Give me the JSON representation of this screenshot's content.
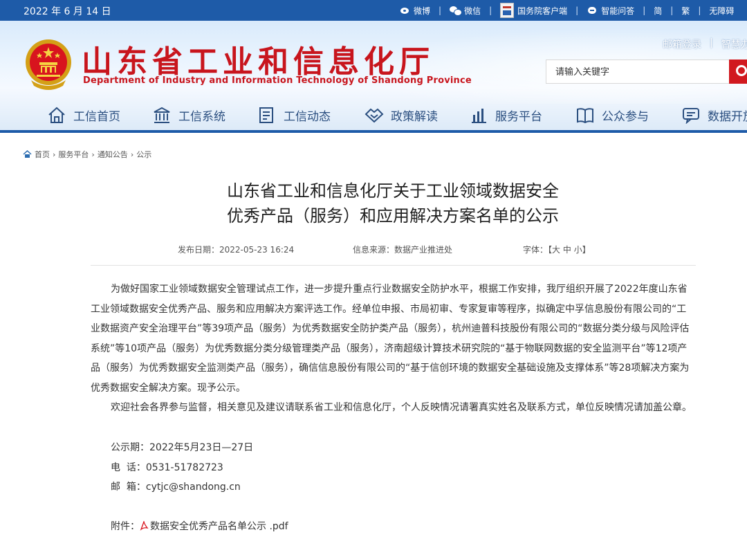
{
  "topbar": {
    "date": "2022 年 6 月 14 日",
    "links": [
      {
        "label": "微博",
        "icon": "weibo-icon"
      },
      {
        "label": "微信",
        "icon": "wechat-icon"
      },
      {
        "label": "国务院客户端",
        "icon": "state-council-app-icon"
      },
      {
        "label": "智能问答",
        "icon": "robot-icon"
      },
      {
        "label": "简"
      },
      {
        "label": "繁"
      },
      {
        "label": "无障碍"
      }
    ],
    "separator": "|"
  },
  "header": {
    "title": "山东省工业和信息化厅",
    "subtitle": "Department of Industry and Information Technology of Shandong Province",
    "login": "邮箱登录",
    "login_sep": "|",
    "smart": "智慧办公",
    "search_placeholder": "请输入关键字",
    "brand_red": "#c8151d",
    "nav_blue": "#1e5ba8"
  },
  "nav": [
    {
      "label": "工信首页",
      "icon": "home-icon"
    },
    {
      "label": "工信系统",
      "icon": "institution-icon"
    },
    {
      "label": "工信动态",
      "icon": "news-icon"
    },
    {
      "label": "政策解读",
      "icon": "handshake-icon"
    },
    {
      "label": "服务平台",
      "icon": "chart-bars-icon"
    },
    {
      "label": "公众参与",
      "icon": "book-icon"
    },
    {
      "label": "数据开放",
      "icon": "chat-icon"
    }
  ],
  "breadcrumb": [
    "首页",
    "服务平台",
    "通知公告",
    "公示"
  ],
  "breadcrumb_sep": "›",
  "article": {
    "title_line1": "山东省工业和信息化厅关于工业领域数据安全",
    "title_line2": "优秀产品（服务）和应用解决方案名单的公示",
    "publish_date": "发布日期：2022-05-23 16:24",
    "source": "信息来源：数据产业推进处",
    "font_size_label": "字体：【",
    "font_large": "大",
    "font_medium": "中",
    "font_small": "小",
    "font_close": "】",
    "paragraph1": "为做好国家工业领域数据安全管理试点工作，进一步提升重点行业数据安全防护水平，根据工作安排，我厅组织开展了2022年度山东省工业领域数据安全优秀产品、服务和应用解决方案评选工作。经单位申报、市局初审、专家复审等程序，拟确定中孚信息股份有限公司的“工业数据资产安全治理平台”等39项产品（服务）为优秀数据安全防护类产品（服务），杭州迪普科技股份有限公司的“数据分类分级与风险评估系统”等10项产品（服务）为优秀数据分类分级管理类产品（服务），济南超级计算技术研究院的“基于物联网数据的安全监测平台”等12项产品（服务）为优秀数据安全监测类产品（服务），确信信息股份有限公司的“基于信创环境的数据安全基础设施及支撑体系”等28项解决方案为优秀数据安全解决方案。现予公示。",
    "paragraph2": "欢迎社会各界参与监督，相关意见及建议请联系省工业和信息化厅，个人反映情况请署真实姓名及联系方式，单位反映情况请加盖公章。",
    "period": "公示期：2022年5月23日—27日",
    "phone": "电  话：0531-51782723",
    "email": "邮  箱：cytjc@shandong.cn",
    "attachment_label": "附件：",
    "attachment_file": "数据安全优秀产品名单公示 .pdf"
  }
}
